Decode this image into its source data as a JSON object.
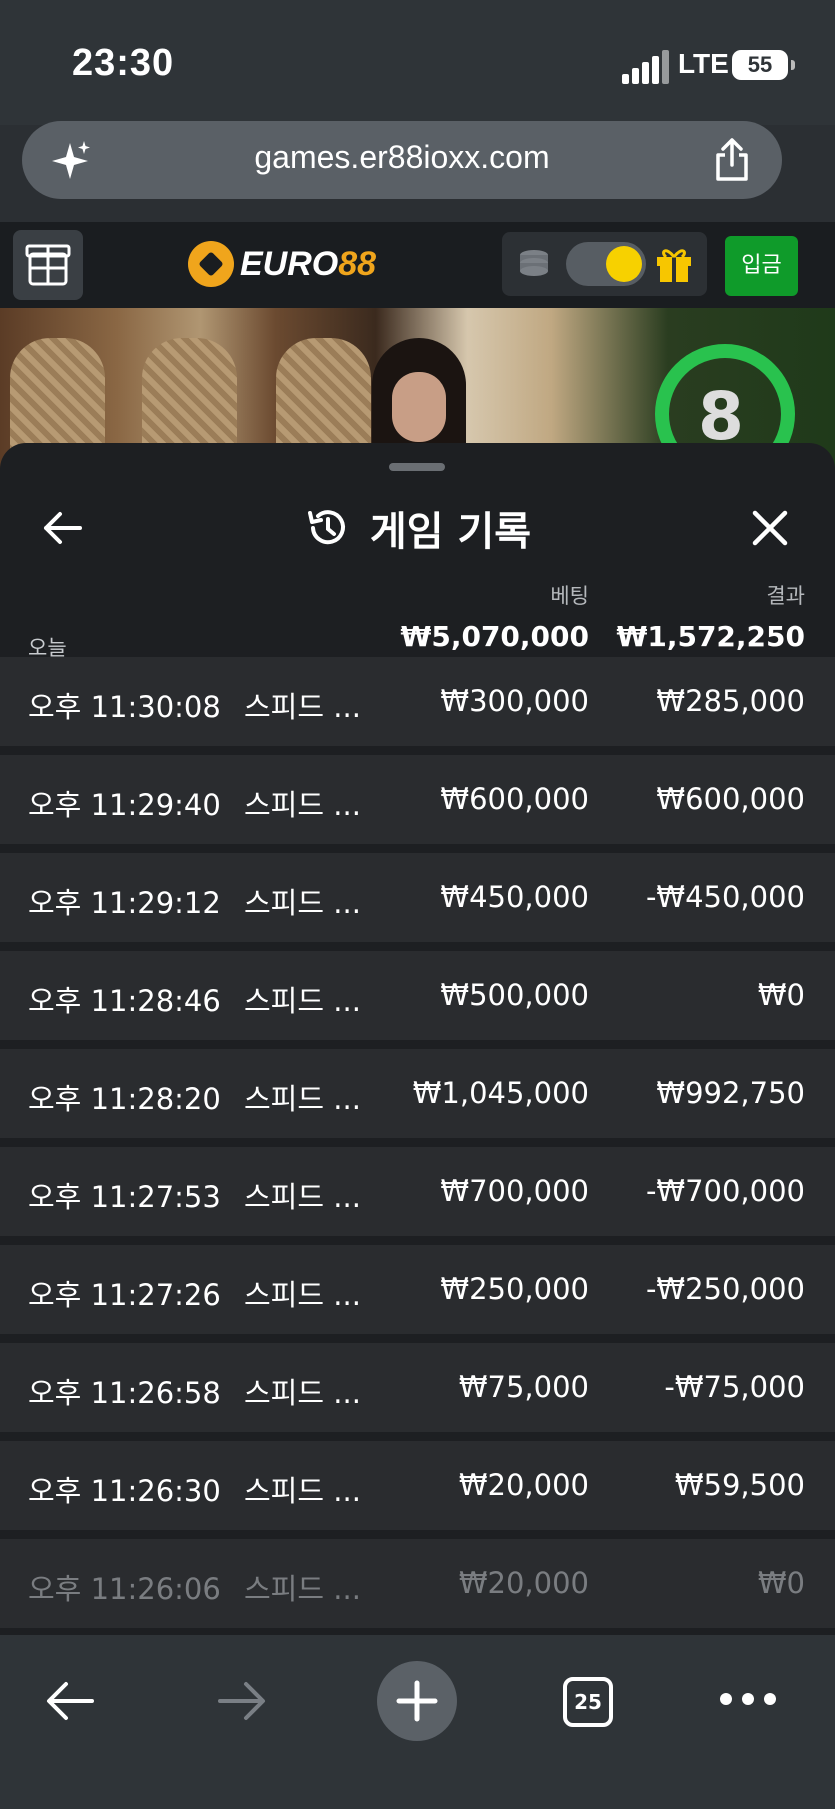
{
  "status_bar": {
    "time": "23:30",
    "network": "LTE",
    "battery": "55"
  },
  "browser": {
    "url": "games.er88ioxx.com",
    "tab_count": "25"
  },
  "site": {
    "logo_prefix": "EURO",
    "logo_suffix": "88",
    "deposit_label": "입금",
    "toggle_on": true,
    "colors": {
      "accent_gold": "#f0a51c",
      "deposit_green": "#0f9b2a",
      "timer_green": "#29c24e"
    }
  },
  "video": {
    "countdown": "8"
  },
  "history": {
    "title": "게임 기록",
    "bet_header": "베팅",
    "result_header": "결과",
    "period_label": "오늘",
    "total_bet": "₩5,070,000",
    "total_result": "₩1,572,250",
    "rows": [
      {
        "time": "오후 11:30:08",
        "game": "스피드 ...",
        "bet": "₩300,000",
        "result": "₩285,000"
      },
      {
        "time": "오후 11:29:40",
        "game": "스피드 ...",
        "bet": "₩600,000",
        "result": "₩600,000"
      },
      {
        "time": "오후 11:29:12",
        "game": "스피드 ...",
        "bet": "₩450,000",
        "result": "-₩450,000"
      },
      {
        "time": "오후 11:28:46",
        "game": "스피드 ...",
        "bet": "₩500,000",
        "result": "₩0"
      },
      {
        "time": "오후 11:28:20",
        "game": "스피드 ...",
        "bet": "₩1,045,000",
        "result": "₩992,750"
      },
      {
        "time": "오후 11:27:53",
        "game": "스피드 ...",
        "bet": "₩700,000",
        "result": "-₩700,000"
      },
      {
        "time": "오후 11:27:26",
        "game": "스피드 ...",
        "bet": "₩250,000",
        "result": "-₩250,000"
      },
      {
        "time": "오후 11:26:58",
        "game": "스피드 ...",
        "bet": "₩75,000",
        "result": "-₩75,000"
      },
      {
        "time": "오후 11:26:30",
        "game": "스피드 ...",
        "bet": "₩20,000",
        "result": "₩59,500"
      },
      {
        "time": "오후 11:26:06",
        "game": "스피드 ...",
        "bet": "₩20,000",
        "result": "₩0"
      }
    ]
  }
}
